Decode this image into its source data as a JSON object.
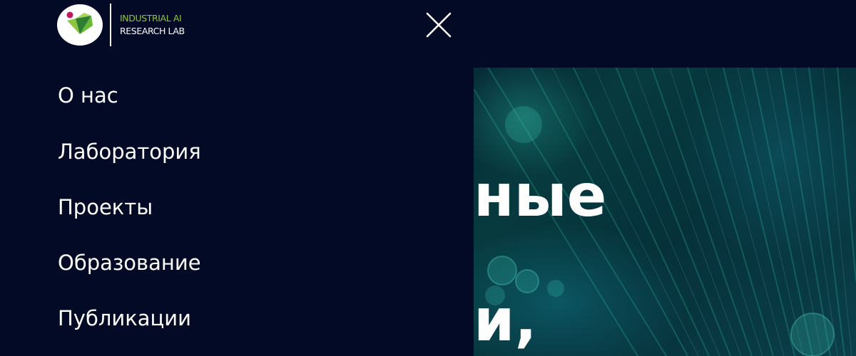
{
  "header": {
    "logo_line_1": "INDUSTRIAL AI",
    "logo_line_2": "RESEARCH LAB",
    "logo_icon": "lab-logo-icon",
    "close_icon": "close-icon"
  },
  "menu": {
    "items": [
      {
        "label": "О нас"
      },
      {
        "label": "Лаборатория"
      },
      {
        "label": "Проекты"
      },
      {
        "label": "Образование"
      },
      {
        "label": "Публикации"
      }
    ]
  },
  "hero": {
    "line_1": "ные",
    "line_2": "и,"
  },
  "colors": {
    "background": "#020a26",
    "logo_accent_green": "#8cc63f",
    "logo_accent_magenta": "#c2185b",
    "text": "#ffffff"
  }
}
